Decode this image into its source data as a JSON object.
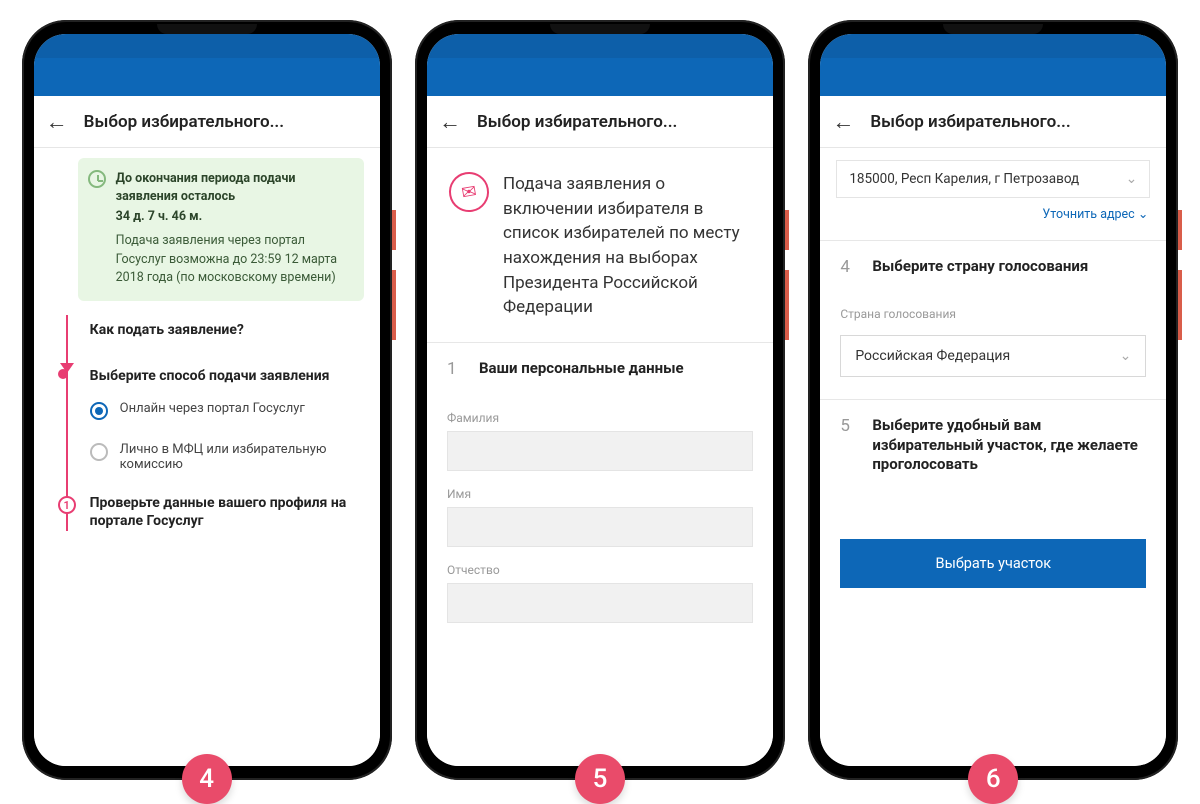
{
  "app_title": "Выбор избирательного...",
  "screen4": {
    "notice_title": "До окончания периода подачи заявления осталось",
    "notice_time": "34 д. 7 ч. 46 м.",
    "notice_body": "Подача заявления через портал Госуслуг возможна до 23:59 12 марта 2018 года (по московскому времени)",
    "q1": "Как подать заявление?",
    "q2": "Выберите способ подачи заявления",
    "opt_online": "Онлайн через портал Госуслуг",
    "opt_mfc": "Лично в МФЦ или избирательную комиссию",
    "step1_num": "1",
    "step1_title": "Проверьте данные вашего профиля на портале Госуслуг",
    "badge": "4"
  },
  "screen5": {
    "heading": "Подача заявления о включении избирателя в список избирателей по месту нахождения на выборах Президента Российской Федерации",
    "step_num": "1",
    "step_title": "Ваши персональные данные",
    "f_lastname": "Фамилия",
    "f_firstname": "Имя",
    "f_patronymic": "Отчество",
    "badge": "5"
  },
  "screen6": {
    "address": "185000, Респ Карелия, г Петрозавод",
    "refine": "Уточнить адрес",
    "step4_num": "4",
    "step4_title": "Выберите страну голосования",
    "country_label": "Страна голосования",
    "country_value": "Российская Федерация",
    "step5_num": "5",
    "step5_title": "Выберите удобный вам избирательный участок, где желаете проголосовать",
    "cta": "Выбрать участок",
    "badge": "6"
  }
}
